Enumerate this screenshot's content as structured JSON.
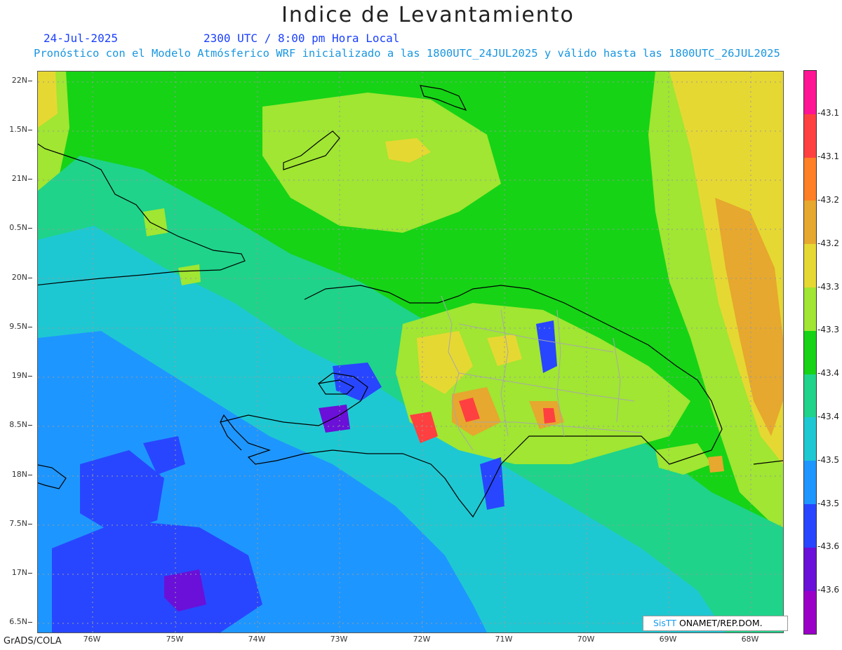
{
  "title": "Indice de Levantamiento",
  "date": "24-Jul-2025",
  "time_label": "2300 UTC / 8:00 pm Hora Local",
  "model_line": "Pronóstico con el Modelo Atmósferico WRF inicializado a las 1800UTC_24JUL2025 y válido hasta las  1800UTC_26JUL2025",
  "lat_labels": [
    "22N",
    "1.5N",
    "21N",
    "0.5N",
    "20N",
    "9.5N",
    "19N",
    "8.5N",
    "18N",
    "7.5N",
    "17N",
    "6.5N"
  ],
  "lon_labels": [
    "76W",
    "75W",
    "74W",
    "73W",
    "72W",
    "71W",
    "70W",
    "69W",
    "68W"
  ],
  "colorbar": {
    "labels": [
      "-43.1",
      "-43.1",
      "-43.2",
      "-43.2",
      "-43.3",
      "-43.3",
      "-43.4",
      "-43.4",
      "-43.5",
      "-43.5",
      "-43.6",
      "-43.6"
    ],
    "colors": [
      "#ff1493",
      "#ff4040",
      "#ff7f27",
      "#e6a82e",
      "#e6d832",
      "#a0e632",
      "#16d316",
      "#1fd38a",
      "#1ec8d2",
      "#1e96ff",
      "#2846ff",
      "#6a10d8",
      "#9a00c8"
    ]
  },
  "palette": {
    "green": "#16d316",
    "light_green": "#a0e632",
    "yellow": "#e6d832",
    "gold": "#e6a82e",
    "teal": "#1fd38a",
    "cyan": "#1ec8d2",
    "light_blue": "#1e96ff",
    "blue": "#2846ff",
    "purple": "#6a10d8",
    "orange": "#ff7f27",
    "red": "#ff4040"
  },
  "watermark": {
    "logo": "SisTT",
    "org": " ONAMET/REP.DOM."
  },
  "footer": "GrADS/COLA"
}
